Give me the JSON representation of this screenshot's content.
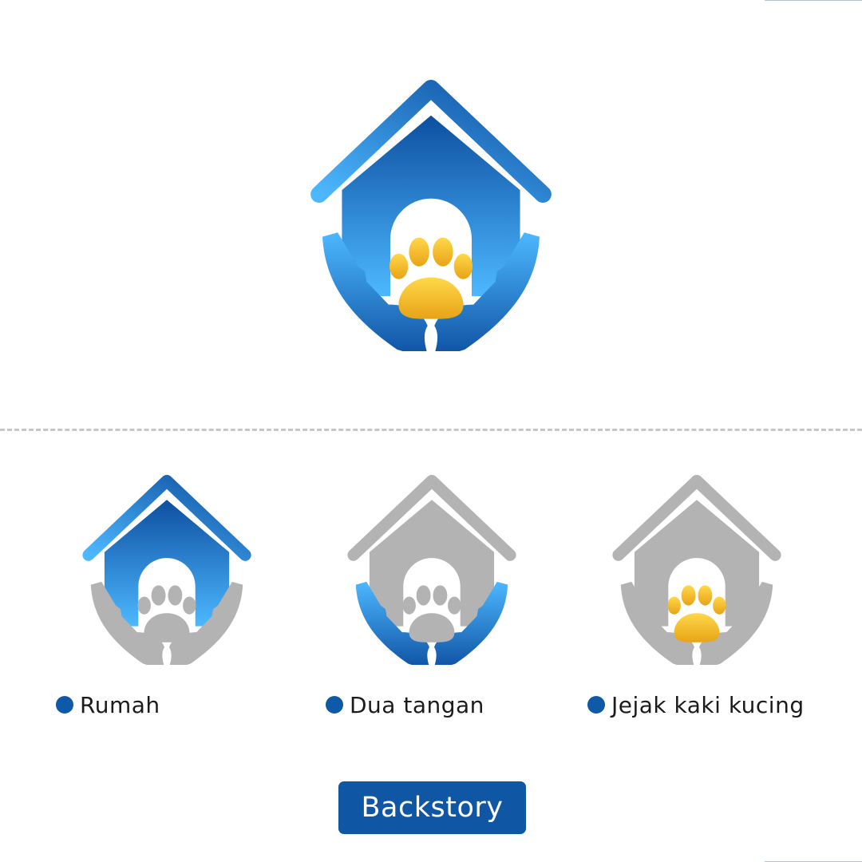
{
  "colors": {
    "blue_dark": "#0d4fa0",
    "blue_light": "#4db8ff",
    "gold_light": "#ffd84a",
    "gold_dark": "#e8a317",
    "grey": "#b3b3b3",
    "bullet": "#0f5aa8",
    "button_bg": "#0f56a4",
    "divider": "#c6c6c6"
  },
  "logo": {
    "icon": "house-hands-paw-logo"
  },
  "legend": [
    {
      "label": "Rumah",
      "highlight": "house"
    },
    {
      "label": "Dua tangan",
      "highlight": "hands"
    },
    {
      "label": "Jejak kaki kucing",
      "highlight": "paw"
    }
  ],
  "button": {
    "label": "Backstory"
  }
}
